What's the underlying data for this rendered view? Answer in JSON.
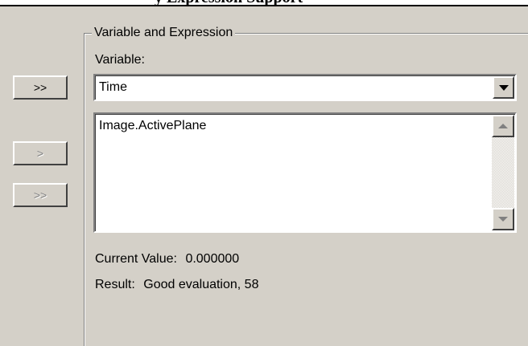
{
  "header": {
    "text": "y Expression Support"
  },
  "side_buttons": [
    {
      "label": ">>",
      "enabled": true
    },
    {
      "label": ">",
      "enabled": false
    },
    {
      "label": ">>",
      "enabled": false
    }
  ],
  "group": {
    "title": "Variable and Expression",
    "variable_label": "Variable:",
    "variable_value": "Time",
    "expression": "Image.ActivePlane",
    "current_value_label": "Current Value:",
    "current_value": "0.000000",
    "result_label": "Result:",
    "result_value": "Good evaluation, 58"
  }
}
